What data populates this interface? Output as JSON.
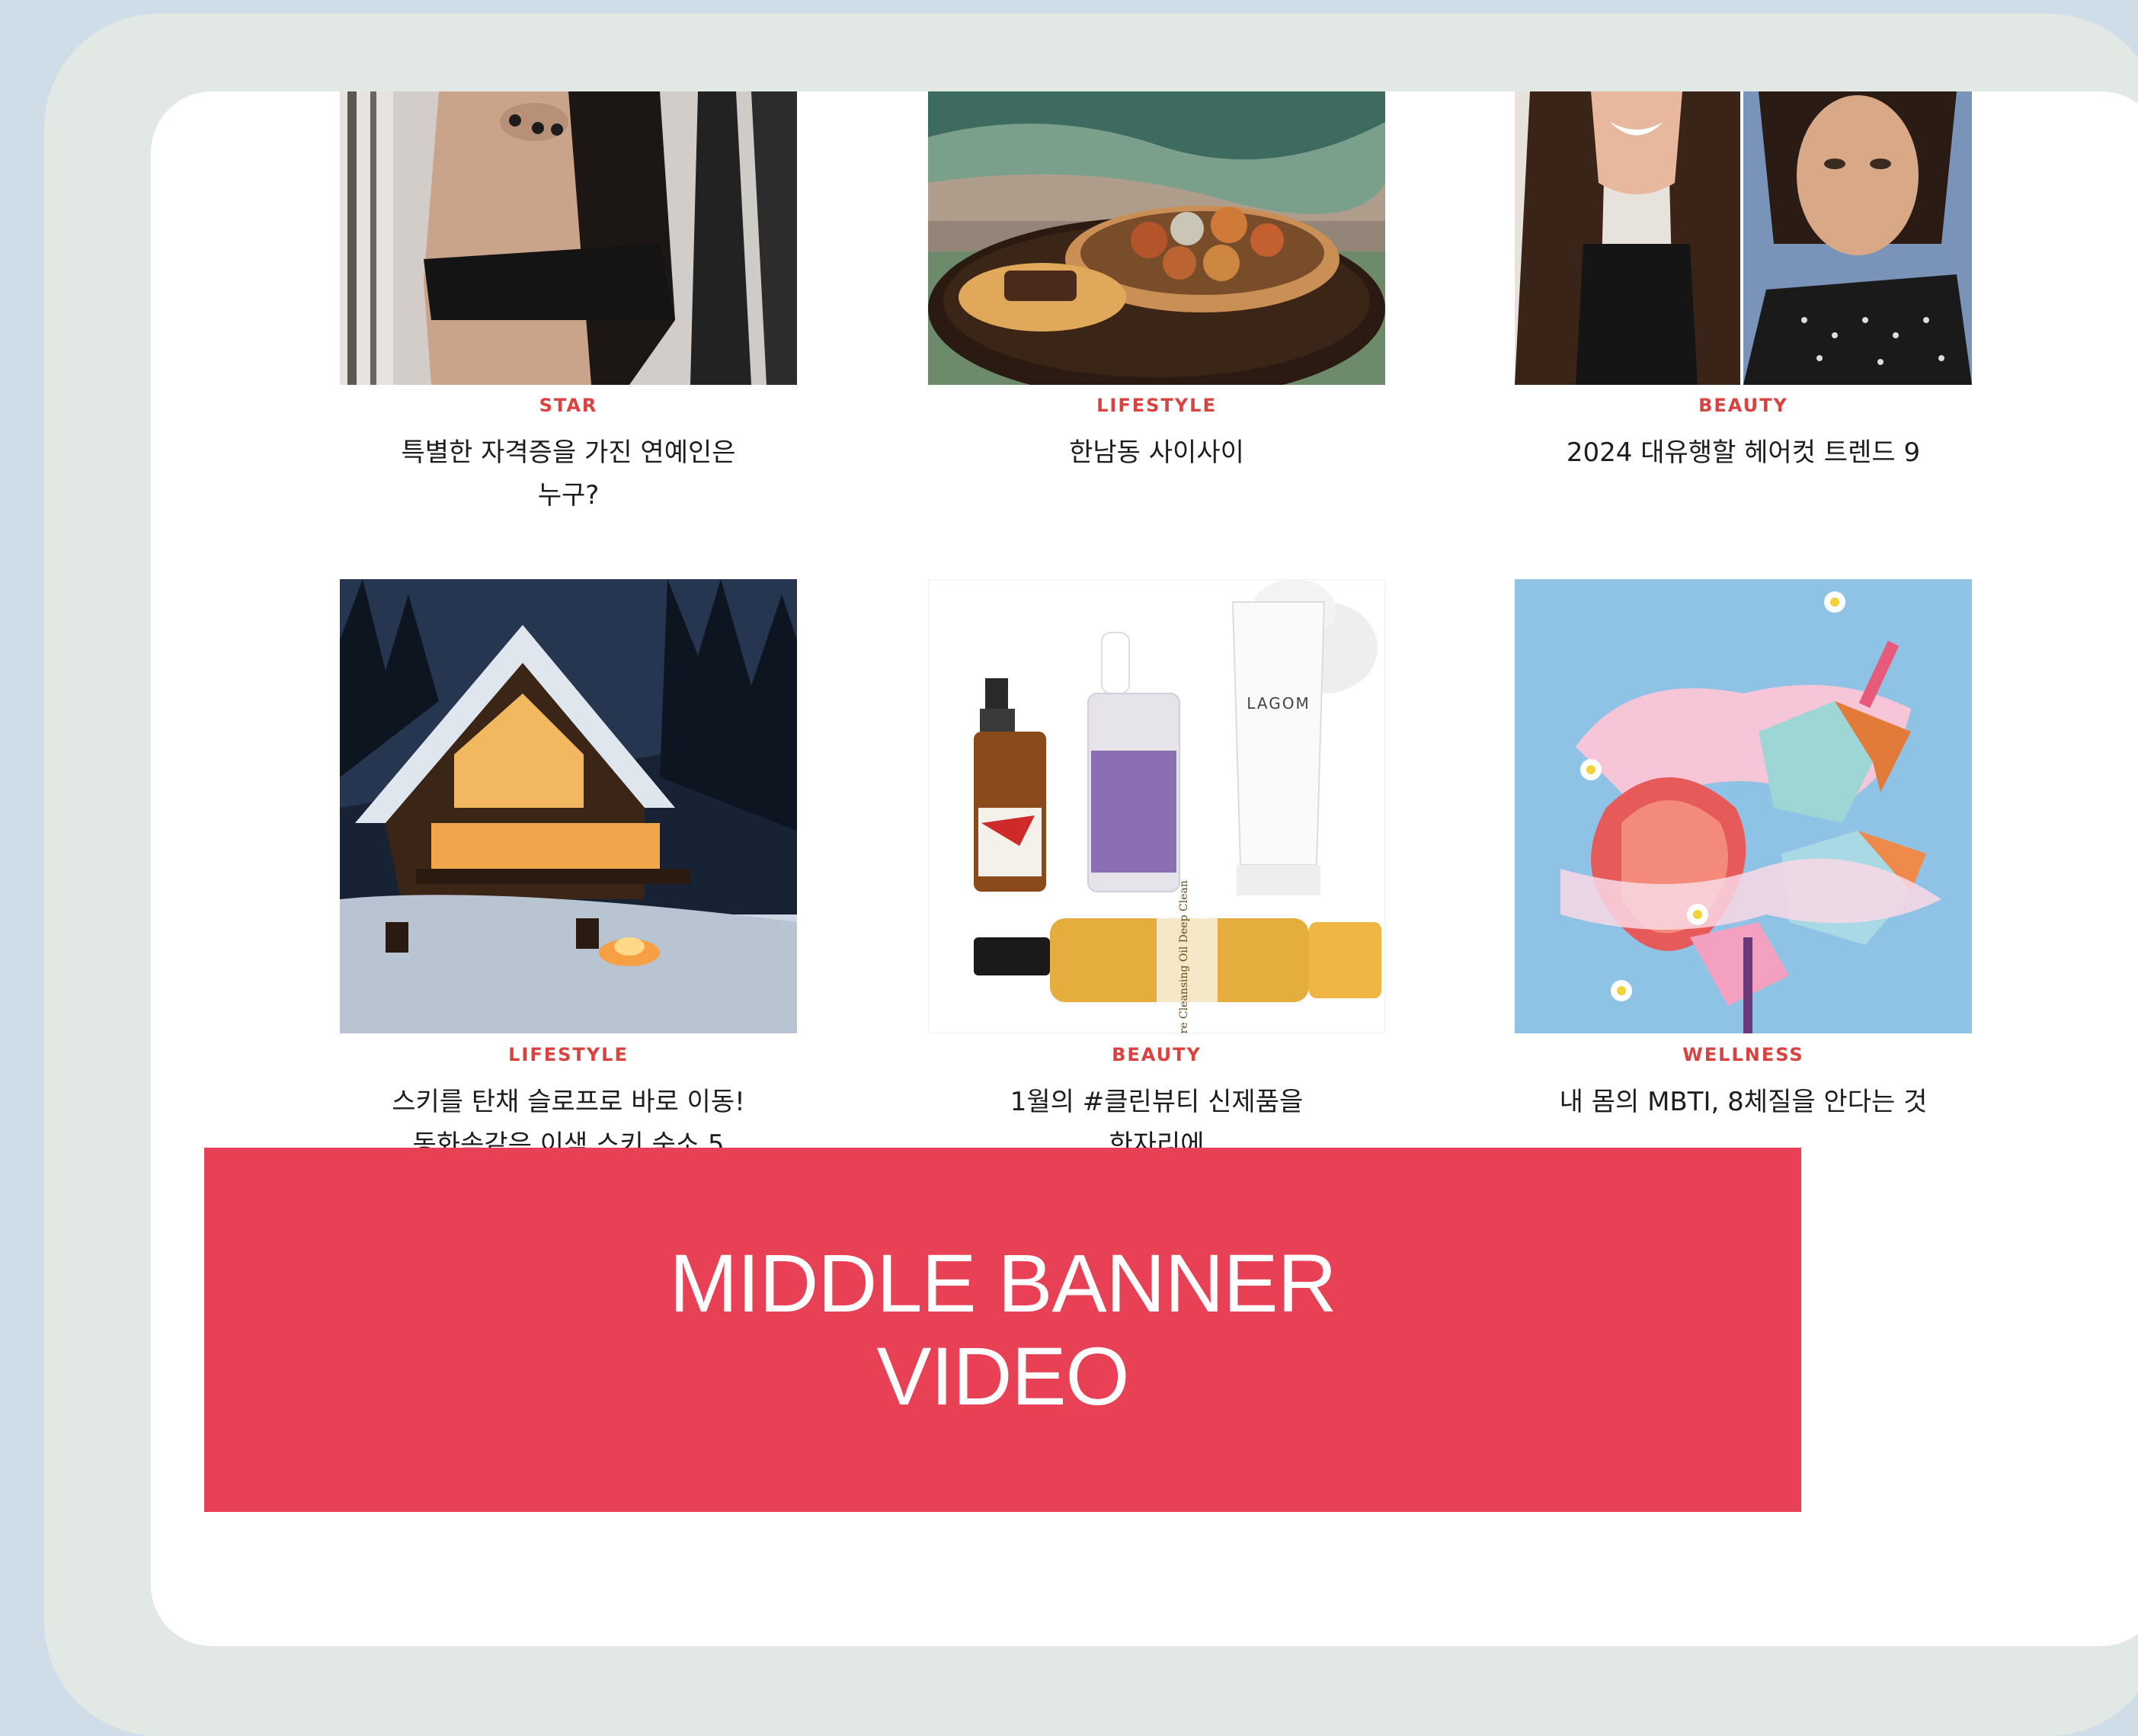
{
  "articles": [
    {
      "category": "STAR",
      "title": "특별한 자격증을 가진 연예인은\n누구?",
      "image": "woman-black-top-photo"
    },
    {
      "category": "LIFESTYLE",
      "title": "한남동 사이사이",
      "image": "pastries-on-tray-photo"
    },
    {
      "category": "BEAUTY",
      "title": "2024 대유행할 헤어컷 트렌드 9",
      "image": "two-women-portrait-photo"
    },
    {
      "category": "LIFESTYLE",
      "title": "스키를 탄채 슬로프로 바로 이동!\n동화속같은 이색 스키 숙소 5",
      "image": "snowy-a-frame-cabin-photo"
    },
    {
      "category": "BEAUTY",
      "title": "1월의 #클린뷰티 신제품을\n한자리에",
      "image": "skincare-products-photo"
    },
    {
      "category": "WELLNESS",
      "title": "내 몸의 MBTI, 8체질을 안다는 것",
      "image": "heart-illustration"
    }
  ],
  "product_labels": {
    "lagom": "LAGOM",
    "oil": "Pure Cleansing Oil Deep Clean"
  },
  "banner": {
    "text": "MIDDLE BANNER\nVIDEO"
  },
  "colors": {
    "accent": "#e84054",
    "category": "#d9423f",
    "frame": "#e2e8e4",
    "backdrop": "#cfdde9"
  }
}
